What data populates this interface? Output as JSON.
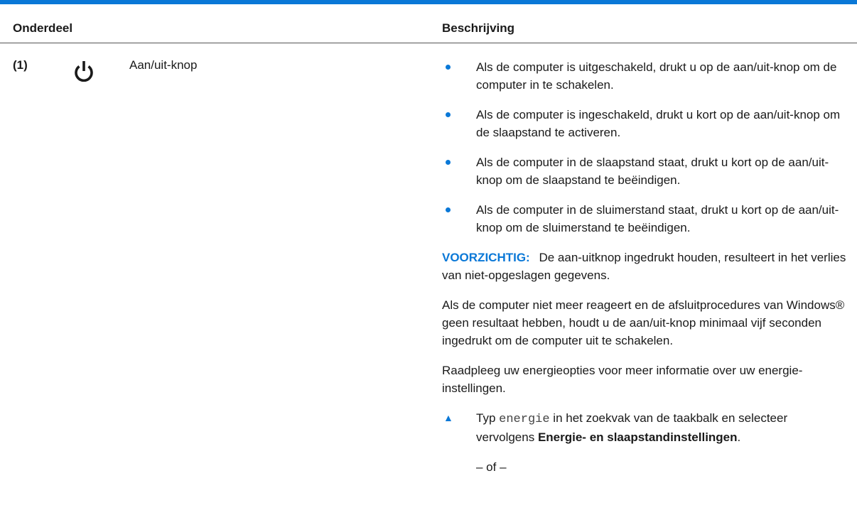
{
  "table": {
    "col_component": "Onderdeel",
    "col_description": "Beschrijving"
  },
  "row": {
    "number": "(1)",
    "icon": "power-icon",
    "name": "Aan/uit-knop",
    "bullets": [
      "Als de computer is uitgeschakeld, drukt u op de aan/uit-knop om de computer in te schakelen.",
      "Als de computer is ingeschakeld, drukt u kort op de aan/uit-knop om de slaapstand te activeren.",
      "Als de computer in de slaapstand staat, drukt u kort op de aan/uit-knop om de slaapstand te beëindigen.",
      "Als de computer in de sluimerstand staat, drukt u kort op de aan/uit-knop om de sluimerstand te beëindigen."
    ],
    "caution_label": "VOORZICHTIG:",
    "caution_text": "De aan-uitknop ingedrukt houden, resulteert in het verlies van niet-opgeslagen gegevens.",
    "paragraph1": "Als de computer niet meer reageert en de afsluitprocedures van Windows® geen resultaat hebben, houdt u de aan/uit-knop minimaal vijf seconden ingedrukt om de computer uit te schakelen.",
    "paragraph2": "Raadpleeg uw energieopties voor meer informatie over uw energie-instellingen.",
    "step": {
      "prefix": "Typ",
      "code": "energie",
      "middle": "in het zoekvak van de taakbalk en selecteer vervolgens",
      "bold": "Energie- en slaapstandinstellingen",
      "suffix": "."
    },
    "or_text": "– of –"
  },
  "colors": {
    "accent": "#0a78d7"
  }
}
